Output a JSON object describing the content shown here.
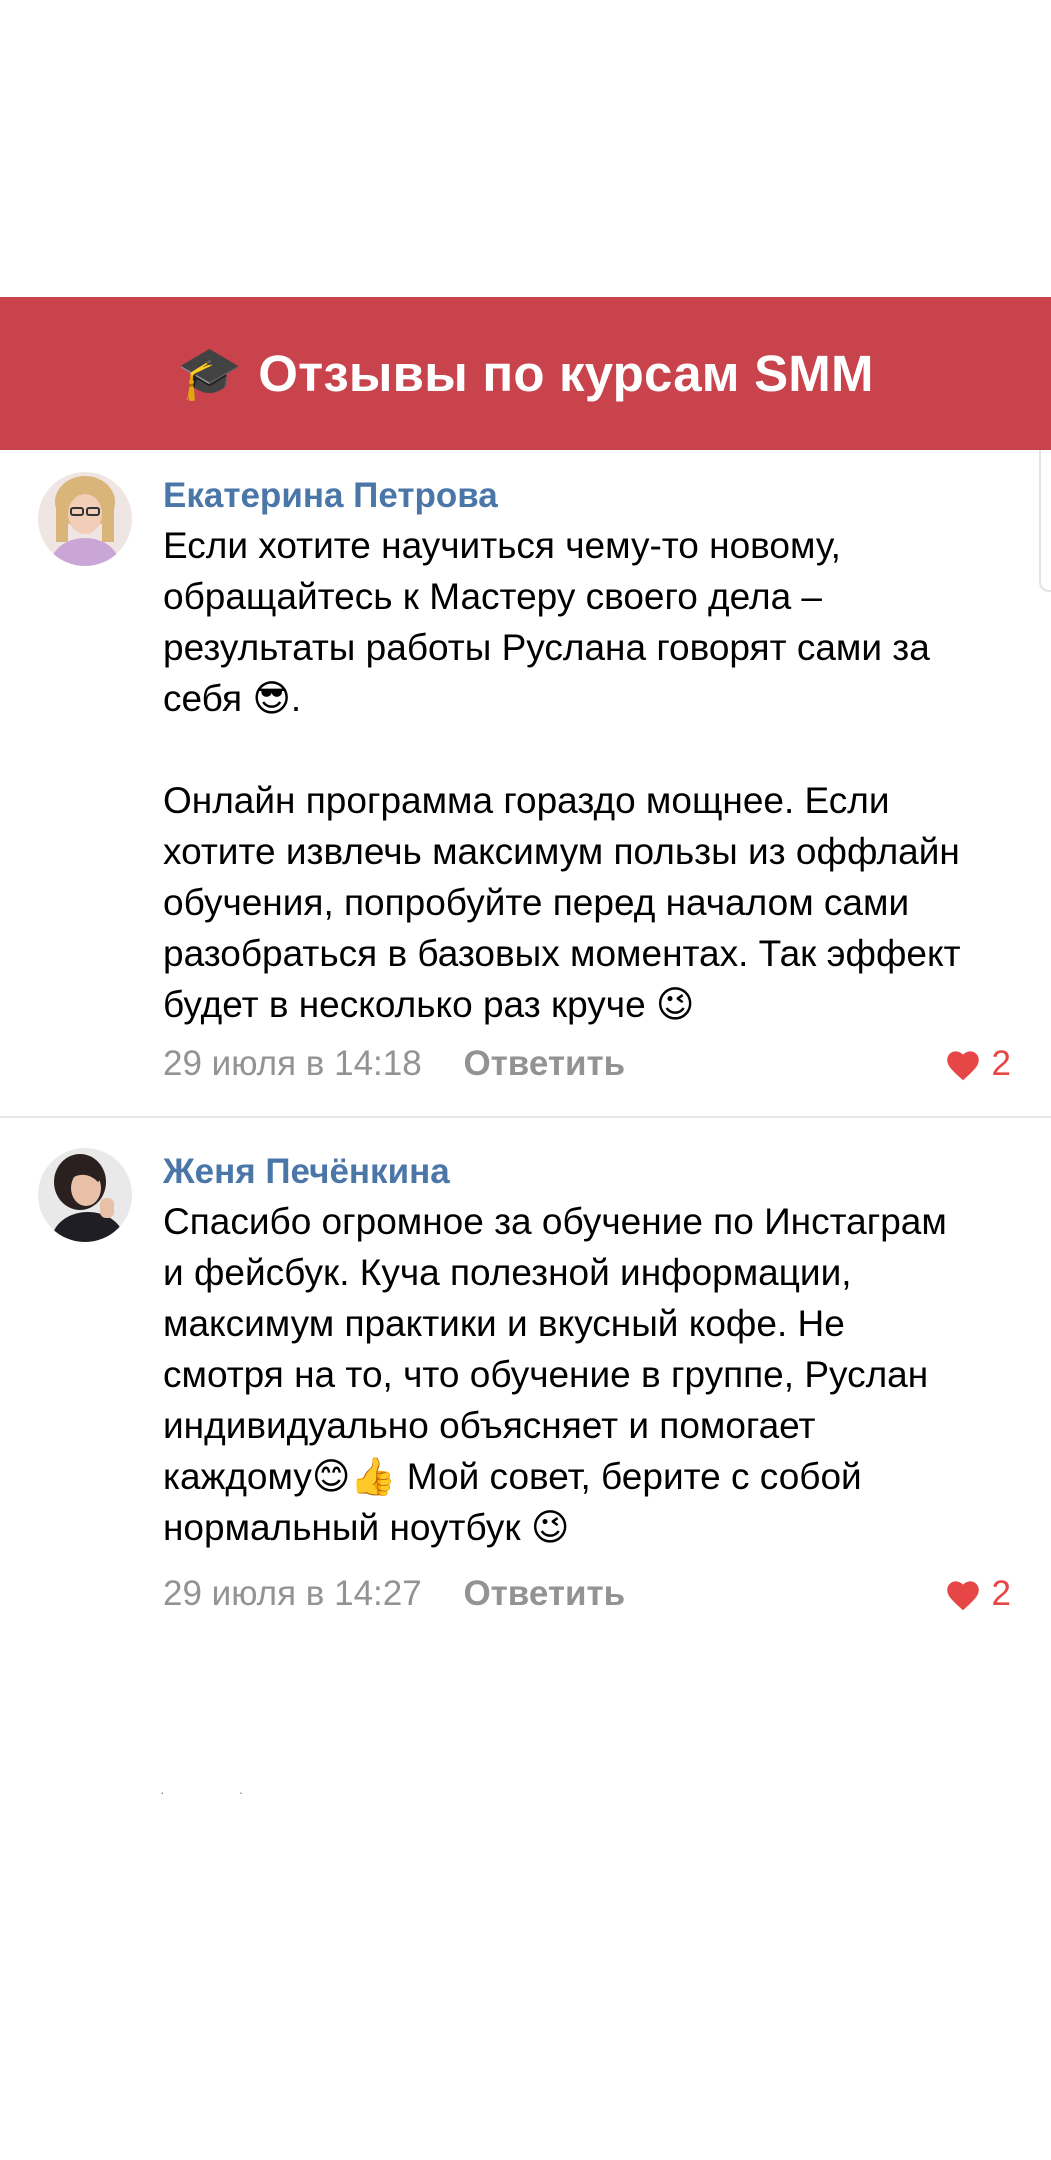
{
  "banner": {
    "icon": "graduation-cap-icon",
    "cap_glyph": "🎓",
    "title": "Отзывы по курсам SMM",
    "color": "#c8434b"
  },
  "comments": [
    {
      "author": "Екатерина Петрова",
      "avatar": "avatar-photo-woman-glasses",
      "text": "Если хотите научиться чему-то новому,\nобращайтесь к Мастеру своего дела –\nрезультаты работы Руслана говорят сами за\nсебя 😎.\n\nОнлайн программа гораздо мощнее. Если\nхотите извлечь максимум пользы из оффлайн\nобучения, попробуйте перед началом сами\nразобраться в базовых моментах. Так эффект\nбудет в несколько раз круче 😉",
      "date": "29 июля в 14:18",
      "reply_label": "Ответить",
      "likes": "2"
    },
    {
      "author": "Женя Печёнкина",
      "avatar": "avatar-photo-woman-dark-hair",
      "text": "Спасибо огромное за обучение по Инстаграм\nи фейсбук. Куча полезной информации,\nмаксимум практики и вкусный кофе. Не\nсмотря на то, что обучение в группе, Руслан\nиндивидуально объясняет и помогает\nкаждому😊👍 Мой совет, берите с собой\nнормальный ноутбук 😉",
      "date": "29 июля в 14:27",
      "reply_label": "Ответить",
      "likes": "2"
    }
  ],
  "colors": {
    "author": "#4a76a8",
    "meta": "#939393",
    "like": "#e64646"
  }
}
